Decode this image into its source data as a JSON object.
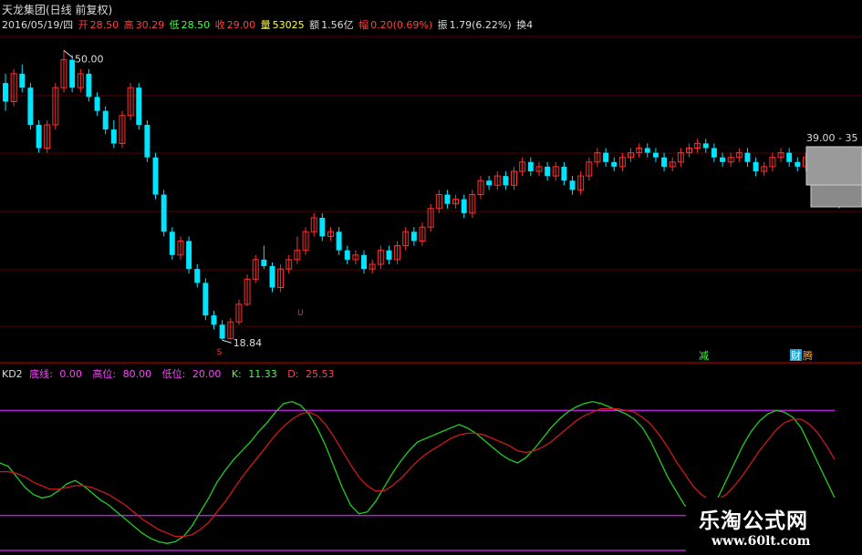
{
  "header": {
    "title": "天龙集团(日线 前复权)",
    "date": "2016/05/19/四",
    "open_label": "开",
    "open": "28.50",
    "high_label": "高",
    "high": "30.29",
    "low_label": "低",
    "low": "28.50",
    "close_label": "收",
    "close": "29.00",
    "vol_label": "量",
    "vol": "53025",
    "amt_label": "额",
    "amt": "1.56亿",
    "chg_label": "幅",
    "chg": "0.20(0.69%)",
    "amp_label": "振",
    "amp": "1.79(6.22%)",
    "turn_label": "换4"
  },
  "annotations": {
    "high_mark": "50.00",
    "low_mark": "18.84",
    "right_price": "39.00 - 35",
    "tag_s": "S",
    "tag_u": "U",
    "tag_jian": "减",
    "tag_caibao": "财",
    "tag_teng": "腾"
  },
  "indicator": {
    "name": "KD2",
    "lines": [
      {
        "label": "底线:",
        "value": "0.00",
        "color": "#ff44ff"
      },
      {
        "label": "高位:",
        "value": "80.00",
        "color": "#ff44ff"
      },
      {
        "label": "低位:",
        "value": "20.00",
        "color": "#ff44ff"
      },
      {
        "label": "K:",
        "value": "11.33",
        "color": "#44ff44"
      },
      {
        "label": "D:",
        "value": "25.53",
        "color": "#ff4444"
      }
    ]
  },
  "watermark": {
    "name": "乐淘公式网",
    "url": "www.60lt.com"
  },
  "colors": {
    "up": "#ff3030",
    "down": "#00e5ff",
    "k": "#22cc22",
    "d": "#cc1a1a",
    "level": "#b020d0",
    "grid": "#5a0000"
  },
  "chart_data": [
    {
      "type": "candlestick",
      "title": "天龙集团(日线 前复权)",
      "ylim": [
        17,
        52
      ],
      "labels": {
        "max": "50.00",
        "min": "18.84"
      },
      "candles": [
        [
          46.5,
          44.5,
          47.5,
          43.5
        ],
        [
          44.5,
          47.5,
          48.0,
          44.0
        ],
        [
          47.5,
          46.0,
          48.5,
          45.5
        ],
        [
          46.0,
          42.0,
          46.5,
          41.5
        ],
        [
          42.0,
          39.5,
          42.5,
          39.0
        ],
        [
          39.5,
          42.0,
          42.5,
          39.0
        ],
        [
          42.0,
          46.0,
          46.5,
          41.5
        ],
        [
          46.0,
          49.0,
          50.0,
          45.5
        ],
        [
          49.0,
          46.0,
          49.5,
          45.5
        ],
        [
          46.0,
          47.5,
          48.0,
          45.5
        ],
        [
          47.5,
          45.0,
          48.0,
          44.5
        ],
        [
          45.0,
          43.5,
          45.5,
          43.0
        ],
        [
          43.5,
          41.5,
          44.0,
          41.0
        ],
        [
          41.5,
          40.0,
          42.5,
          39.5
        ],
        [
          40.0,
          43.0,
          43.5,
          39.5
        ],
        [
          43.0,
          46.0,
          46.5,
          42.5
        ],
        [
          46.0,
          42.0,
          46.5,
          41.5
        ],
        [
          42.0,
          38.5,
          42.5,
          38.0
        ],
        [
          38.5,
          34.5,
          39.0,
          34.0
        ],
        [
          34.5,
          30.5,
          35.0,
          30.0
        ],
        [
          30.5,
          28.0,
          31.0,
          27.5
        ],
        [
          28.0,
          29.5,
          30.0,
          27.5
        ],
        [
          29.5,
          26.5,
          30.0,
          26.0
        ],
        [
          26.5,
          25.0,
          27.0,
          24.5
        ],
        [
          25.0,
          21.5,
          25.5,
          21.0
        ],
        [
          21.5,
          20.5,
          22.0,
          20.0
        ],
        [
          20.5,
          19.0,
          21.0,
          18.84
        ],
        [
          19.0,
          20.8,
          21.2,
          18.9
        ],
        [
          20.8,
          22.7,
          23.2,
          20.5
        ],
        [
          22.7,
          25.4,
          25.9,
          22.5
        ],
        [
          25.4,
          27.5,
          28.0,
          25.0
        ],
        [
          27.5,
          26.8,
          29.0,
          26.5
        ],
        [
          26.8,
          24.5,
          27.2,
          24.0
        ],
        [
          24.5,
          26.5,
          27.0,
          24.0
        ],
        [
          26.5,
          27.5,
          28.0,
          26.0
        ],
        [
          27.5,
          28.5,
          30.0,
          27.0
        ],
        [
          28.5,
          30.5,
          31.0,
          28.0
        ],
        [
          30.5,
          32.0,
          32.5,
          30.0
        ],
        [
          32.0,
          30.0,
          32.5,
          29.5
        ],
        [
          30.0,
          30.5,
          31.0,
          29.5
        ],
        [
          30.5,
          28.5,
          31.0,
          28.0
        ],
        [
          28.5,
          27.5,
          29.0,
          27.0
        ],
        [
          27.5,
          28.0,
          28.5,
          27.0
        ],
        [
          28.0,
          26.5,
          28.5,
          26.0
        ],
        [
          26.5,
          27.0,
          27.5,
          26.0
        ],
        [
          27.0,
          28.5,
          29.0,
          26.5
        ],
        [
          28.5,
          27.5,
          29.0,
          27.0
        ],
        [
          27.5,
          29.0,
          29.5,
          27.0
        ],
        [
          29.0,
          30.5,
          31.0,
          28.5
        ],
        [
          30.5,
          29.5,
          31.0,
          29.0
        ],
        [
          29.5,
          31.0,
          31.5,
          29.0
        ],
        [
          31.0,
          33.0,
          33.5,
          30.5
        ],
        [
          33.0,
          34.5,
          35.0,
          32.5
        ],
        [
          34.5,
          33.5,
          35.0,
          33.0
        ],
        [
          33.5,
          34.0,
          34.5,
          33.0
        ],
        [
          34.0,
          32.5,
          34.5,
          32.0
        ],
        [
          32.5,
          34.5,
          35.0,
          32.0
        ],
        [
          34.5,
          36.0,
          36.5,
          34.0
        ],
        [
          36.0,
          35.5,
          36.5,
          35.0
        ],
        [
          35.5,
          36.5,
          37.0,
          35.0
        ],
        [
          36.5,
          35.5,
          37.0,
          35.0
        ],
        [
          35.5,
          37.0,
          37.5,
          35.0
        ],
        [
          37.0,
          38.0,
          38.5,
          36.5
        ],
        [
          38.0,
          37.0,
          38.5,
          36.5
        ],
        [
          37.0,
          37.5,
          38.0,
          36.5
        ],
        [
          37.5,
          36.5,
          38.0,
          36.0
        ],
        [
          36.5,
          37.5,
          38.0,
          36.0
        ],
        [
          37.5,
          36.0,
          38.0,
          35.5
        ],
        [
          36.0,
          35.0,
          36.5,
          34.5
        ],
        [
          35.0,
          36.5,
          37.0,
          34.5
        ],
        [
          36.5,
          38.0,
          38.5,
          36.0
        ],
        [
          38.0,
          39.0,
          39.5,
          37.5
        ],
        [
          39.0,
          38.0,
          39.5,
          37.5
        ],
        [
          38.0,
          37.5,
          38.5,
          37.0
        ],
        [
          37.5,
          38.5,
          39.0,
          37.0
        ],
        [
          38.5,
          39.0,
          39.5,
          38.0
        ],
        [
          39.0,
          39.5,
          40.0,
          38.5
        ],
        [
          39.5,
          39.0,
          40.0,
          38.5
        ],
        [
          39.0,
          38.5,
          39.5,
          38.0
        ],
        [
          38.5,
          37.5,
          39.0,
          37.0
        ],
        [
          37.5,
          38.0,
          38.5,
          37.0
        ],
        [
          38.0,
          39.0,
          39.5,
          37.5
        ],
        [
          39.0,
          39.5,
          40.0,
          38.5
        ],
        [
          39.5,
          40.0,
          40.5,
          39.0
        ],
        [
          40.0,
          39.5,
          40.5,
          39.0
        ],
        [
          39.5,
          38.5,
          40.0,
          38.0
        ],
        [
          38.5,
          38.0,
          39.0,
          37.5
        ],
        [
          38.0,
          38.5,
          39.0,
          37.5
        ],
        [
          38.5,
          39.0,
          39.5,
          38.0
        ],
        [
          39.0,
          38.0,
          39.5,
          37.5
        ],
        [
          38.0,
          37.0,
          38.5,
          36.5
        ],
        [
          37.0,
          37.5,
          38.0,
          36.5
        ],
        [
          37.5,
          38.5,
          39.0,
          37.0
        ],
        [
          38.5,
          39.0,
          39.5,
          38.0
        ],
        [
          39.0,
          38.0,
          39.5,
          37.5
        ],
        [
          38.0,
          37.5,
          38.5,
          37.0
        ],
        [
          37.5,
          38.5,
          39.0,
          37.0
        ],
        [
          38.5,
          39.0,
          39.5,
          38.0
        ],
        [
          39.0,
          37.0,
          39.5,
          36.5
        ],
        [
          37.0,
          35.0,
          37.5,
          34.5
        ],
        [
          35.0,
          33.5,
          35.5,
          33.0
        ]
      ]
    },
    {
      "type": "line",
      "title": "KD2",
      "ylim": [
        0,
        100
      ],
      "reference_lines": {
        "底线": 0,
        "高位": 80,
        "低位": 20
      },
      "series": [
        {
          "name": "K",
          "values": [
            50,
            48,
            42,
            36,
            32,
            30,
            31,
            34,
            38,
            40,
            37,
            33,
            29,
            26,
            22,
            18,
            14,
            10,
            7,
            5,
            4,
            5,
            8,
            14,
            22,
            30,
            39,
            46,
            52,
            57,
            62,
            68,
            73,
            79,
            84,
            85,
            83,
            78,
            70,
            60,
            48,
            36,
            26,
            21,
            22,
            28,
            36,
            44,
            51,
            57,
            62,
            64,
            66,
            68,
            70,
            72,
            70,
            67,
            63,
            59,
            55,
            52,
            50,
            53,
            58,
            64,
            70,
            75,
            79,
            82,
            84,
            85,
            84,
            82,
            80,
            78,
            75,
            70,
            62,
            52,
            42,
            34,
            26,
            22,
            20,
            23,
            30,
            40,
            50,
            60,
            68,
            74,
            78,
            80,
            79,
            76,
            70,
            60,
            50,
            40,
            30
          ]
        },
        {
          "name": "D",
          "values": [
            45,
            45,
            44,
            42,
            39,
            37,
            35,
            35,
            36,
            37,
            37,
            36,
            34,
            32,
            29,
            26,
            22,
            18,
            15,
            12,
            10,
            8,
            8,
            9,
            12,
            16,
            22,
            28,
            35,
            42,
            48,
            54,
            60,
            66,
            71,
            75,
            78,
            79,
            77,
            72,
            65,
            57,
            49,
            42,
            37,
            34,
            34,
            37,
            41,
            46,
            51,
            55,
            58,
            61,
            64,
            66,
            67,
            67,
            66,
            64,
            62,
            60,
            57,
            56,
            57,
            59,
            62,
            66,
            70,
            74,
            77,
            79,
            81,
            81,
            81,
            80,
            79,
            76,
            72,
            66,
            59,
            51,
            44,
            37,
            32,
            29,
            29,
            32,
            37,
            43,
            50,
            57,
            63,
            69,
            73,
            75,
            75,
            72,
            67,
            60,
            52
          ]
        }
      ]
    }
  ]
}
